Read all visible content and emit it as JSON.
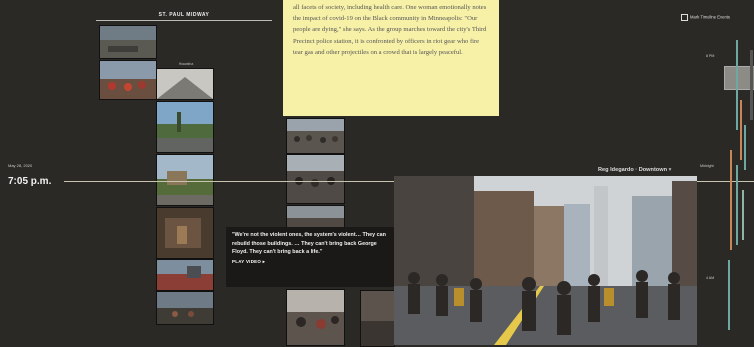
{
  "column_header": "ST. PAUL MIDWAY",
  "sub_caption": "Hiawatha",
  "timestamp": {
    "date": "May 28, 2020",
    "time": "7:05 p.m."
  },
  "note_text": "all facets of society, including health care. One woman emotionally notes the impact of covid-19 on the Black community in Minneapolis: \"Our people are dying,\" she says. As the group marches toward the city's Third Precinct police station, it is confronted by officers in riot gear who fire tear gas and other projectiles on a crowd that is largely peaceful.",
  "quote": {
    "text": "\"We're not the violent ones, the system's violent… They can rebuild those buildings. … They can't bring back George Floyd. They can't bring back a life.\"",
    "play_label": "PLAY VIDEO ▸"
  },
  "video_header": {
    "title": "Reg Idegardo · Downtown",
    "expand_icon": "chevron-down-icon"
  },
  "top_right": {
    "checkbox_label": "Mark Timeline Events"
  },
  "right_labels": [
    "8 PM",
    "Midnight",
    "4 AM"
  ],
  "colors": {
    "background": "#2a2926",
    "note": "#f7f1a8",
    "timeline": "#c9c4b0",
    "bar_teal": "#6fa8a0",
    "bar_orange": "#c9855a"
  }
}
